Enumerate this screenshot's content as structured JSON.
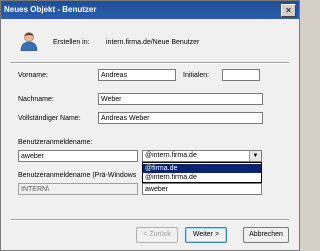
{
  "window": {
    "title": "Neues Objekt - Benutzer",
    "close_glyph": "✕"
  },
  "header": {
    "created_in_label": "Erstellen in:",
    "created_in_value": "intern.firma.de/Neue Benutzer",
    "icon": "user-icon"
  },
  "form": {
    "first_name_label": "Vorname:",
    "first_name_value": "Andreas",
    "initials_label": "Initialen:",
    "initials_value": "",
    "last_name_label": "Nachname:",
    "last_name_value": "Weber",
    "full_name_label": "Vollständiger Name:",
    "full_name_value": "Andreas Weber",
    "logon_name_label": "Benutzeranmeldename:",
    "logon_name_value": "aweber",
    "domain_selected": "@intern.firma.de",
    "domain_options": [
      "@firma.de",
      "@intern.firma.de"
    ],
    "pre2000_label": "Benutzeranmeldename (Prä-Windows",
    "pre2000_domain": "INTERN\\",
    "pre2000_value": "aweber"
  },
  "buttons": {
    "back": "< Zurück",
    "next": "Weiter >",
    "cancel": "Abbrechen"
  },
  "colors": {
    "titlebar": "#1f4e96",
    "selection": "#0a246a"
  }
}
